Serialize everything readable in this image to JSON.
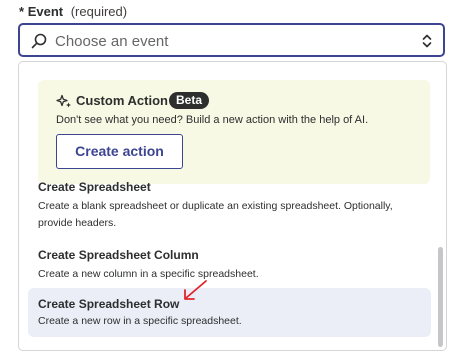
{
  "field": {
    "required_star": "*",
    "label": "Event",
    "hint": "(required)"
  },
  "select": {
    "placeholder": "Choose an event",
    "icons": {
      "search": "search-icon",
      "sort": "up-down-chevron-icon"
    }
  },
  "custom_action": {
    "icon": "sparkle-icon",
    "title": "Custom Action",
    "badge": "Beta",
    "description": "Don't see what you need? Build a new action with the help of AI.",
    "button_label": "Create action"
  },
  "options": [
    {
      "title": "Create Spreadsheet",
      "description": "Create a blank spreadsheet or duplicate an existing spreadsheet. Optionally, provide headers.",
      "highlighted": false
    },
    {
      "title": "Create Spreadsheet Column",
      "description": "Create a new column in a specific spreadsheet.",
      "highlighted": false
    },
    {
      "title": "Create Spreadsheet Row",
      "description": "Create a new row in a specific spreadsheet.",
      "highlighted": true
    }
  ],
  "colors": {
    "accent": "#3d4592",
    "card_bg": "#f7f9e4",
    "highlight_bg": "#eceef7",
    "annotation_arrow": "#e0252b"
  }
}
